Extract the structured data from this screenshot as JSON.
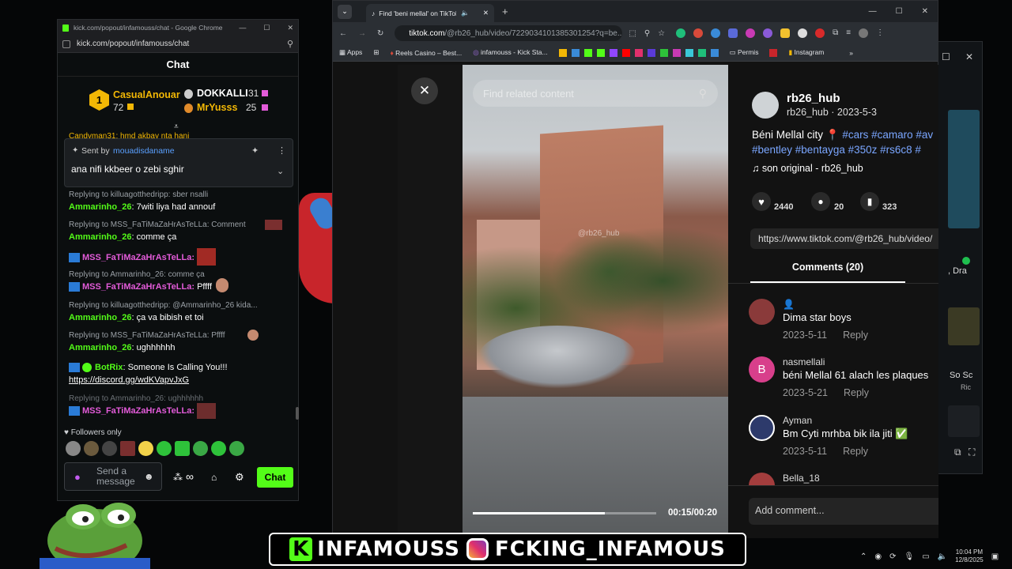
{
  "kick": {
    "window_title": "kick.com/popout/infamouss/chat - Google Chrome",
    "url": "kick.com/popout/infamouss/chat",
    "chat_title": "Chat",
    "leaderboard": [
      {
        "rank": "1",
        "name": "CasualAnouar",
        "score": "72"
      },
      {
        "name": "DOKKALLI",
        "score": "31"
      },
      {
        "name": "MrYusss",
        "score": "25"
      }
    ],
    "partial_line": "Candyman31: hmd akbay nta hani",
    "pinned": {
      "sent_by_label": "Sent by",
      "sent_by_user": "mouadisdaname",
      "text": "ana nifi kkbeer o zebi sghir"
    },
    "messages": [
      {
        "reply": "Replying to killuagotthedripp: sber nsalli",
        "user": "Ammarinho_26",
        "text": ": 7witi liya had annouf",
        "color": "#53fc18"
      },
      {
        "reply": "Replying to MSS_FaTiMaZaHrAsTeLLa: Comment",
        "user": "Ammarinho_26",
        "text": ": comme ça",
        "color": "#53fc18"
      },
      {
        "reply": "",
        "user": "MSS_FaTiMaZaHrAsTeLLa:",
        "text": "",
        "color": "#e35bd9"
      },
      {
        "reply": "Replying to Ammarinho_26: comme ça",
        "user": "MSS_FaTiMaZaHrAsTeLLa:",
        "text": " Pffff",
        "color": "#e35bd9"
      },
      {
        "reply": "Replying to killuagotthedripp: @Ammarinho_26 kida...",
        "user": "Ammarinho_26",
        "text": ": ça va bibish et toi",
        "color": "#53fc18"
      },
      {
        "reply": "Replying to MSS_FaTiMaZaHrAsTeLLa: Pffff",
        "user": "Ammarinho_26",
        "text": ": ughhhhhh",
        "color": "#53fc18"
      },
      {
        "reply": "",
        "user": "BotRix",
        "text": ": Someone Is Calling You!!!",
        "color": "#53fc18"
      },
      {
        "reply": "",
        "user": "",
        "text": "https://discord.gg/wdKVapvJxG",
        "color": "#ffffff"
      },
      {
        "reply": "Replying to Ammarinho_26: ughhhhhh",
        "user": "MSS_FaTiMaZaHrAsTeLLa:",
        "text": "",
        "color": "#e35bd9"
      }
    ],
    "followers_only": "Followers only",
    "send_placeholder": "Send a message",
    "chat_button": "Chat"
  },
  "tiktok": {
    "tab_title": "Find 'beni mellal' on TikTok",
    "url_host": "tiktok.com",
    "url_path": "/@rb26_hub/video/7229034101385301254?q=be...",
    "bookmarks": [
      "Apps",
      "Reels Casino – Best...",
      "infamouss - Kick Sta...",
      "Permis",
      "Instagram"
    ],
    "search_placeholder": "Find related content",
    "watermark": "@rb26_hub",
    "time": "00:15/00:20",
    "progress": 0.72,
    "author": "rb26_hub",
    "author_sub": "rb26_hub · 2023-5-3",
    "caption_text": "Béni Mellal city 📍",
    "caption_tags1": "#cars #camaro #av",
    "caption_tags2": "#bentley #bentayga #350z #rs6c8 #",
    "sound": "son original - rb26_hub",
    "likes": "2440",
    "comments_count": "20",
    "saves": "323",
    "link": "https://www.tiktok.com/@rb26_hub/video/",
    "comments_tab": "Comments (20)",
    "comments": [
      {
        "name": "",
        "text": "Dima star boys",
        "date": "2023-5-11",
        "reply": "Reply",
        "avatar": "#8a3a3a"
      },
      {
        "name": "nasmellali",
        "text": "béni Mellal 61 alach les plaques",
        "date": "2023-5-21",
        "reply": "Reply",
        "avatar": "#d83f8b"
      },
      {
        "name": "Ayman",
        "text": "Bm Cyti mrhba bik ila jiti ✅",
        "date": "2023-5-11",
        "reply": "Reply",
        "avatar": "#2d3a6b"
      },
      {
        "name": "Bella_18",
        "text": "",
        "date": "",
        "reply": "",
        "avatar": "#a33d3d"
      }
    ],
    "add_comment": "Add comment..."
  },
  "background_window": {
    "texts": [
      ", Dra",
      "So Sc",
      "Ric"
    ]
  },
  "overlay": {
    "banner_left": "INFAMOUSS",
    "banner_right": "FCKING_INFAMOUS"
  },
  "taskbar": {
    "time": "10:04 PM",
    "date": "12/8/2025"
  },
  "colors": {
    "kick_green": "#53fc18",
    "link_blue": "#7aa6ff"
  }
}
